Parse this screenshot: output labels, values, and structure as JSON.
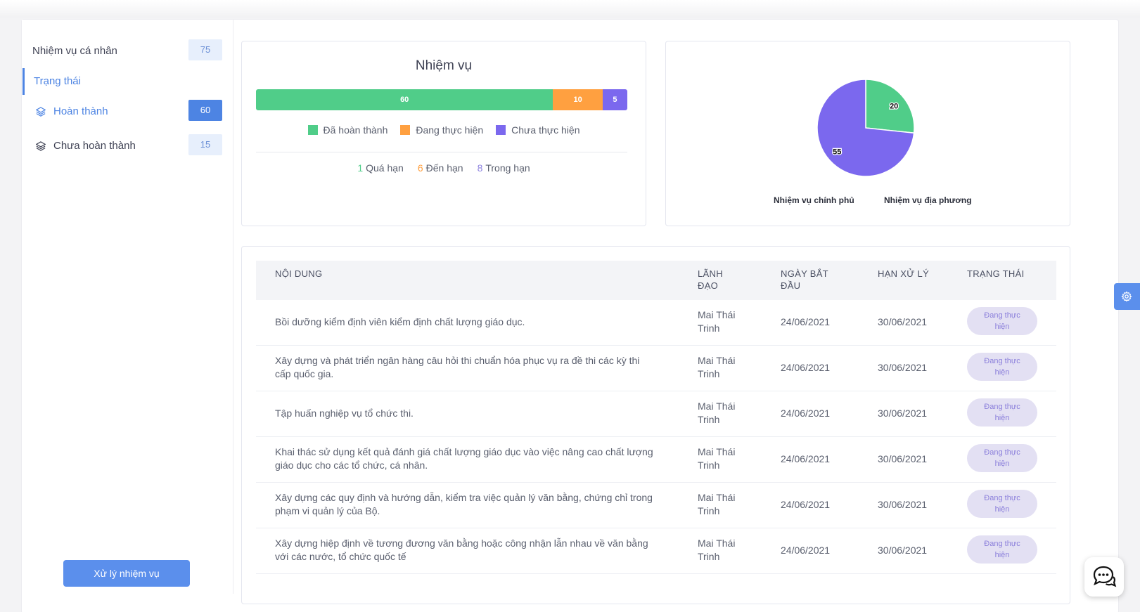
{
  "sidebar": {
    "header_label": "Nhiệm vụ cá nhân",
    "header_count": "75",
    "section_label": "Trạng thái",
    "items": [
      {
        "label": "Hoàn thành",
        "count": "60",
        "icon": "layers-icon"
      },
      {
        "label": "Chưa hoàn thành",
        "count": "15",
        "icon": "layers-icon"
      }
    ],
    "action_button": "Xử lý nhiệm vụ"
  },
  "chart_data": [
    {
      "type": "bar",
      "title": "Nhiệm vụ",
      "stacked": true,
      "orientation": "horizontal",
      "series": [
        {
          "name": "Đã hoàn thành",
          "value": 60,
          "color": "#50cd89"
        },
        {
          "name": "Đang thực hiện",
          "value": 10,
          "color": "#ffa040"
        },
        {
          "name": "Chưa thực hiện",
          "value": 5,
          "color": "#7b68ee"
        }
      ]
    },
    {
      "type": "pie",
      "slices": [
        {
          "label": "Nhiệm vụ chính phủ",
          "value": 20,
          "color": "#50cd89"
        },
        {
          "label": "Nhiệm vụ địa phương",
          "value": 55,
          "color": "#7b68ee"
        }
      ]
    }
  ],
  "deadline_stats": [
    {
      "count": "1",
      "label": "Quá hạn",
      "color": "#50cd89"
    },
    {
      "count": "6",
      "label": "Đến hạn",
      "color": "#ffa040"
    },
    {
      "count": "8",
      "label": "Trong hạn",
      "color": "#8e83df"
    }
  ],
  "table": {
    "headers": {
      "content": "NỘI DUNG",
      "leader_1": "LÃNH",
      "leader_2": "ĐẠO",
      "start_1": "NGÀY BẮT",
      "start_2": "ĐẦU",
      "due": "HẠN XỬ LÝ",
      "status": "TRẠNG THÁI"
    },
    "rows": [
      {
        "content_1": "Bồi dưỡng kiểm định viên kiểm định chất lượng giáo dục.",
        "content_2": "",
        "leader_1": "Mai Thái",
        "leader_2": "Trinh",
        "start": "24/06/2021",
        "due": "30/06/2021",
        "status_1": "Đang thực",
        "status_2": "hiện"
      },
      {
        "content_1": "Xây dựng và phát triển ngân hàng câu hỏi thi chuẩn hóa phục vụ ra đề thi các kỳ thi",
        "content_2": "cấp quốc gia.",
        "leader_1": "Mai Thái",
        "leader_2": "Trinh",
        "start": "24/06/2021",
        "due": "30/06/2021",
        "status_1": "Đang thực",
        "status_2": "hiện"
      },
      {
        "content_1": "Tập huấn nghiệp vụ tổ chức thi.",
        "content_2": "",
        "leader_1": "Mai Thái",
        "leader_2": "Trinh",
        "start": "24/06/2021",
        "due": "30/06/2021",
        "status_1": "Đang thực",
        "status_2": "hiện"
      },
      {
        "content_1": "Khai thác sử dụng kết quả đánh giá chất lượng giáo dục vào việc nâng cao chất lượng",
        "content_2": "giáo dục cho các tổ chức, cá nhân.",
        "leader_1": "Mai Thái",
        "leader_2": "Trinh",
        "start": "24/06/2021",
        "due": "30/06/2021",
        "status_1": "Đang thực",
        "status_2": "hiện"
      },
      {
        "content_1": "Xây dựng các quy định và hướng dẫn, kiểm tra việc quản lý văn bằng, chứng chỉ trong",
        "content_2": "phạm vi quản lý của Bộ.",
        "leader_1": "Mai Thái",
        "leader_2": "Trinh",
        "start": "24/06/2021",
        "due": "30/06/2021",
        "status_1": "Đang thực",
        "status_2": "hiện"
      },
      {
        "content_1": "Xây dựng hiệp định về tương đương văn bằng hoặc công nhận lẫn nhau về văn bằng",
        "content_2": "với các nước, tổ chức quốc tế",
        "leader_1": "Mai Thái",
        "leader_2": "Trinh",
        "start": "24/06/2021",
        "due": "30/06/2021",
        "status_1": "Đang thực",
        "status_2": "hiện"
      }
    ]
  },
  "floating": {
    "settings_icon": "gear-icon",
    "chat_icon": "chat-icon"
  }
}
